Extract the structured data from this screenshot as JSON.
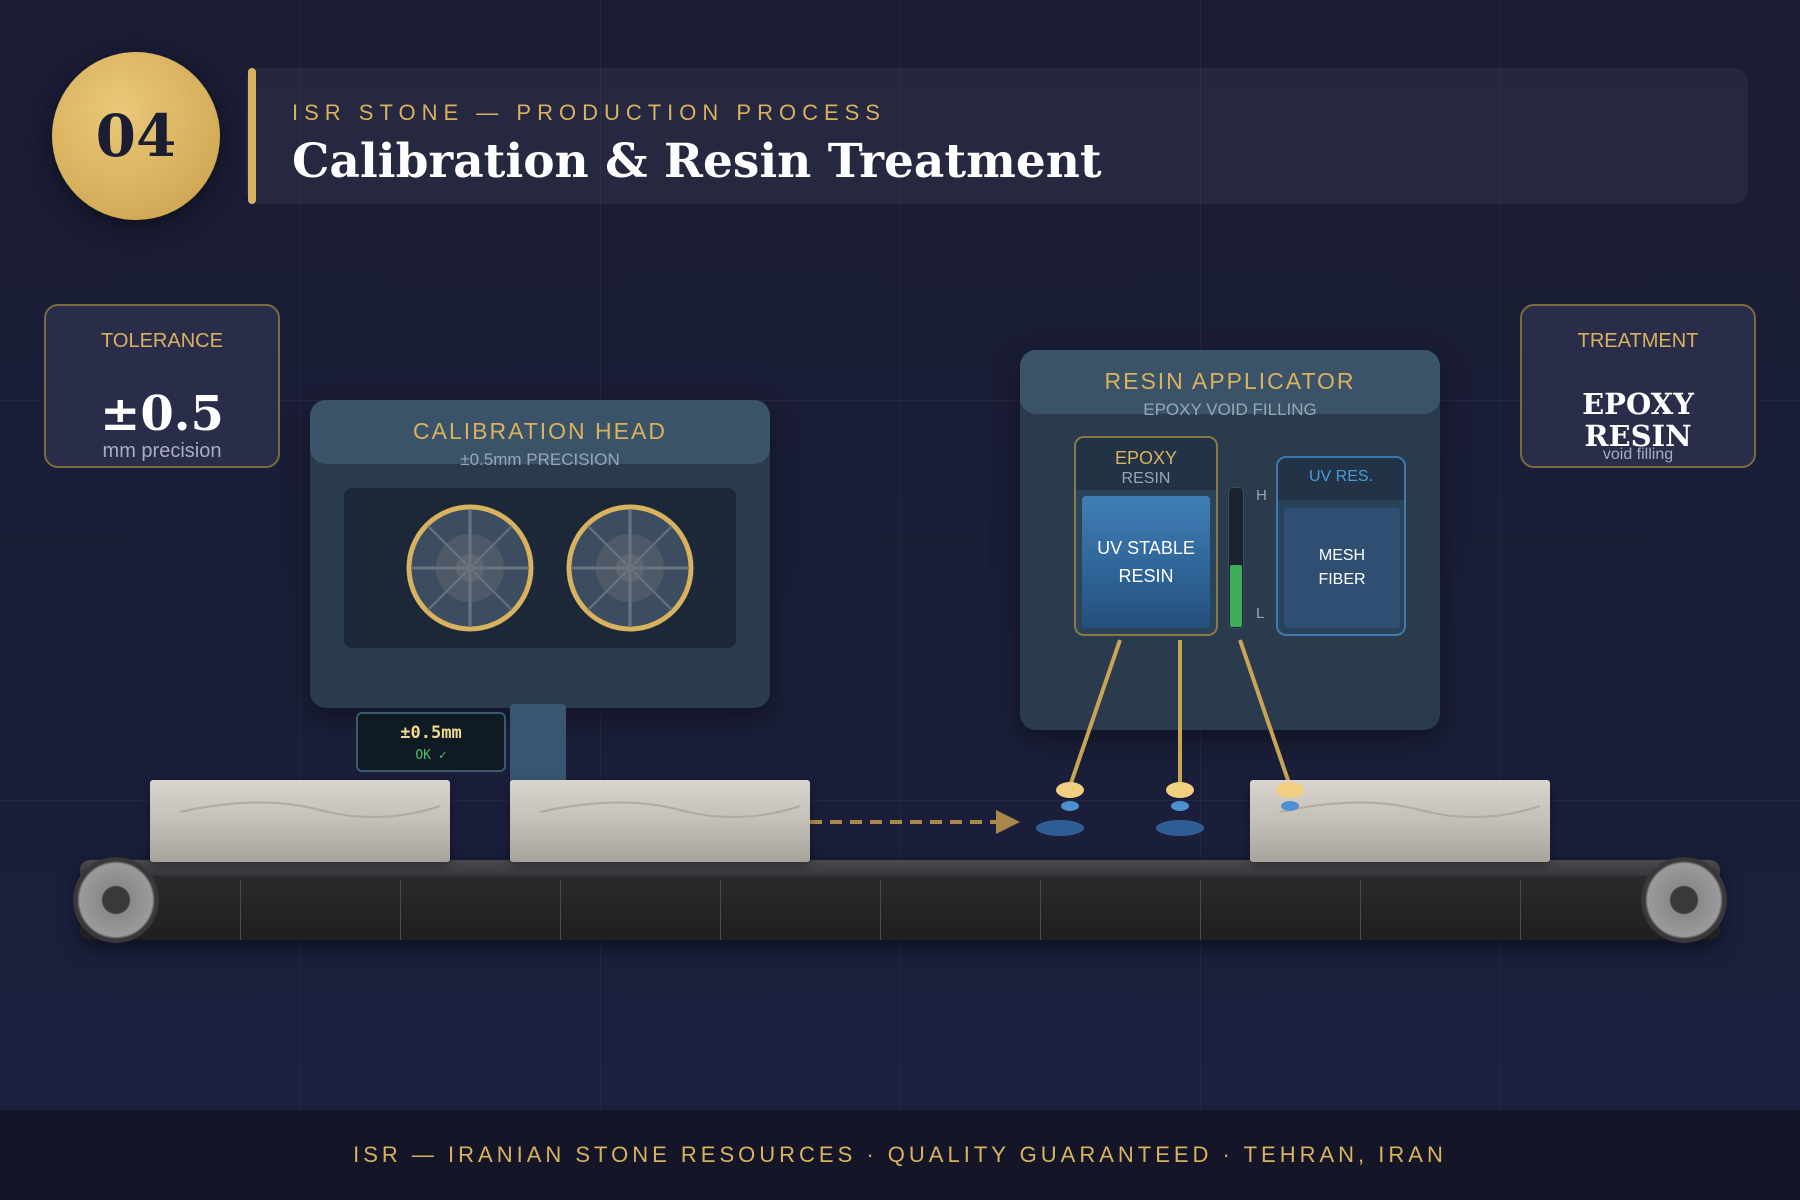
{
  "header": {
    "step_number": "04",
    "kicker": "ISR STONE — PRODUCTION PROCESS",
    "title": "Calibration & Resin Treatment"
  },
  "tolerance_card": {
    "label": "TOLERANCE",
    "value": "±0.5",
    "unit": "mm precision"
  },
  "treatment_card": {
    "label": "TREATMENT",
    "value_line1": "EPOXY",
    "value_line2": "RESIN",
    "sub": "void filling"
  },
  "calibration_head": {
    "title": "CALIBRATION HEAD",
    "subtitle": "±0.5mm PRECISION",
    "readout_value": "±0.5mm",
    "readout_status": "OK ✓"
  },
  "resin_applicator": {
    "title": "RESIN APPLICATOR",
    "subtitle": "EPOXY VOID FILLING",
    "epoxy_tank": {
      "label_line1": "EPOXY",
      "label_line2": "RESIN",
      "content_line1": "UV STABLE",
      "content_line2": "RESIN"
    },
    "uv_tank": {
      "label": "UV RES.",
      "content_line1": "MESH",
      "content_line2": "FIBER"
    },
    "gauge": {
      "high_label": "H",
      "low_label": "L",
      "level_fraction": 0.45
    }
  },
  "footer": {
    "text": "ISR — IRANIAN STONE RESOURCES · QUALITY GUARANTEED · TEHRAN, IRAN"
  },
  "colors": {
    "background": "#1b1c35",
    "gold": "#d9b25f",
    "machine": "#2b3b4e",
    "resin_blue": "#2e6396",
    "gauge_green": "#3fae5c"
  }
}
